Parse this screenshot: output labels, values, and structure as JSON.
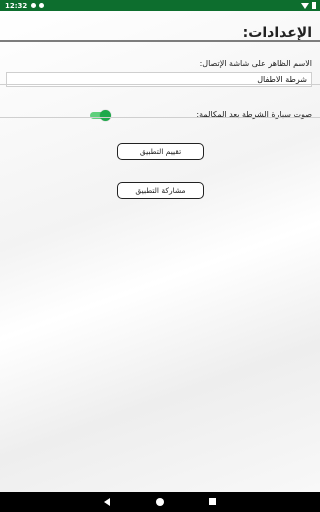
{
  "status_bar": {
    "time": "12:32",
    "icons": [
      "gear-icon",
      "notification-icon",
      "wifi-icon",
      "battery-icon"
    ]
  },
  "settings": {
    "title": "الإعدادات:",
    "display_name_label": "الاسم الظاهر على شاشة الإتصال:",
    "display_name_value": "شرطة الاطفال",
    "siren_sound_label": "صوت سيارة الشرطة بعد المكالمة:",
    "siren_sound_enabled": true,
    "rate_app_label": "تقييم التطبيق",
    "share_app_label": "مشاركة التطبيق"
  },
  "colors": {
    "status_bar": "#0d6e2e",
    "toggle_on": "#1ea94a"
  },
  "nav_bar": {
    "icons": [
      "back-icon",
      "home-icon",
      "recents-icon"
    ]
  }
}
